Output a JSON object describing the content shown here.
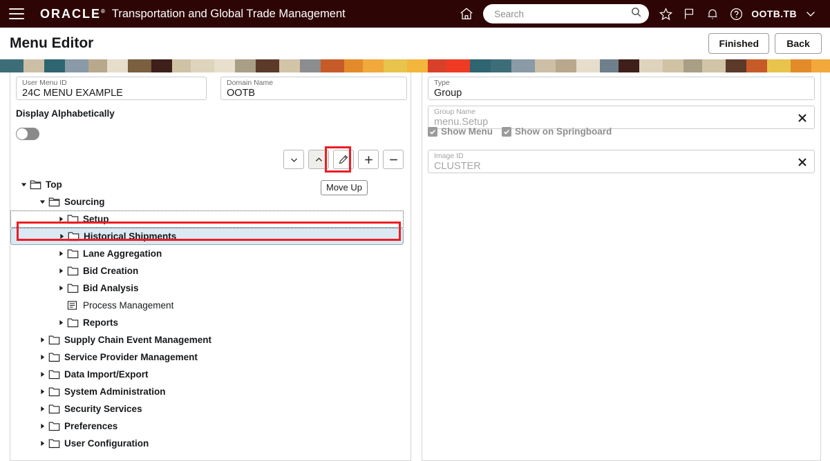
{
  "header": {
    "menu_icon": "hamburger-icon",
    "brand": "ORACLE",
    "brand_mark": "®",
    "app_title": "Transportation and Global Trade Management",
    "home_icon": "home-icon",
    "search_placeholder": "Search",
    "search_value": "",
    "search_icon": "search-icon",
    "favorites_icon": "star-icon",
    "flag_icon": "flag-icon",
    "notifications_icon": "bell-icon",
    "help_icon": "question-circle-icon",
    "user_name": "OOTB.TB",
    "user_chevron_icon": "chevron-down-icon"
  },
  "page": {
    "title": "Menu Editor",
    "finished_label": "Finished",
    "back_label": "Back"
  },
  "banner": {
    "colors": [
      "#3d6e78",
      "#cdbfa6",
      "#2f6570",
      "#8a9aa6",
      "#b9a98c",
      "#e6ddcb",
      "#7b5f3e",
      "#3e1f1a",
      "#cfc2a5",
      "#ded3bc",
      "#e8e0cd",
      "#a99e86",
      "#5c3a2a",
      "#d2c4a6",
      "#8c8d8f",
      "#c75b28",
      "#e38b2a",
      "#f0a93a",
      "#e8c44d",
      "#f2b63c",
      "#d9402a",
      "#ef3b24",
      "#2f6570",
      "#3d6e78",
      "#8a9aa6",
      "#cdbfa6",
      "#b9a98c",
      "#e6ddcb",
      "#6f7f8c",
      "#3e1f1a",
      "#ded3bc",
      "#cfc2a5",
      "#a99e86",
      "#d2c4a6",
      "#5c3a2a",
      "#c75b28",
      "#e8c44d",
      "#e38b2a",
      "#f0a93a",
      "#d9402a"
    ]
  },
  "left_pane": {
    "user_menu_id": {
      "label": "User Menu ID",
      "value": "24C MENU EXAMPLE"
    },
    "domain_name": {
      "label": "Domain Name",
      "value": "OOTB"
    },
    "display_alphabetically": {
      "label": "Display Alphabetically",
      "state": "off"
    },
    "toolbar": [
      {
        "name": "move-down-button",
        "icon": "chevron-down-icon",
        "tooltip": "Move Down",
        "active": false
      },
      {
        "name": "move-up-button",
        "icon": "chevron-up-icon",
        "tooltip": "Move Up",
        "active": true
      },
      {
        "name": "edit-button",
        "icon": "pencil-icon",
        "tooltip": "Edit",
        "active": false
      },
      {
        "name": "add-button",
        "icon": "plus-icon",
        "tooltip": "Add",
        "active": false
      },
      {
        "name": "remove-button",
        "icon": "minus-icon",
        "tooltip": "Remove",
        "active": false
      }
    ],
    "tooltip_text": "Move Up",
    "tree": [
      {
        "label": "Top",
        "level": 0,
        "icon": "folder-open-icon",
        "twist": "expanded",
        "bold": true,
        "state": "normal"
      },
      {
        "label": "Sourcing",
        "level": 1,
        "icon": "folder-open-icon",
        "twist": "expanded",
        "bold": true,
        "state": "normal"
      },
      {
        "label": "Setup",
        "level": 2,
        "icon": "folder-icon",
        "twist": "collapsed",
        "bold": true,
        "state": "focused"
      },
      {
        "label": "Historical Shipments",
        "level": 2,
        "icon": "folder-icon",
        "twist": "collapsed",
        "bold": true,
        "state": "selected"
      },
      {
        "label": "Lane Aggregation",
        "level": 2,
        "icon": "folder-icon",
        "twist": "collapsed",
        "bold": true,
        "state": "normal"
      },
      {
        "label": "Bid Creation",
        "level": 2,
        "icon": "folder-icon",
        "twist": "collapsed",
        "bold": true,
        "state": "normal"
      },
      {
        "label": "Bid Analysis",
        "level": 2,
        "icon": "folder-icon",
        "twist": "collapsed",
        "bold": true,
        "state": "normal"
      },
      {
        "label": "Process Management",
        "level": 2,
        "icon": "document-icon",
        "twist": "none",
        "bold": false,
        "state": "normal"
      },
      {
        "label": "Reports",
        "level": 2,
        "icon": "folder-icon",
        "twist": "collapsed",
        "bold": true,
        "state": "normal"
      },
      {
        "label": "Supply Chain Event Management",
        "level": 1,
        "icon": "folder-icon",
        "twist": "collapsed",
        "bold": true,
        "state": "normal"
      },
      {
        "label": "Service Provider Management",
        "level": 1,
        "icon": "folder-icon",
        "twist": "collapsed",
        "bold": true,
        "state": "normal"
      },
      {
        "label": "Data Import/Export",
        "level": 1,
        "icon": "folder-icon",
        "twist": "collapsed",
        "bold": true,
        "state": "normal"
      },
      {
        "label": "System Administration",
        "level": 1,
        "icon": "folder-icon",
        "twist": "collapsed",
        "bold": true,
        "state": "normal"
      },
      {
        "label": "Security Services",
        "level": 1,
        "icon": "folder-icon",
        "twist": "collapsed",
        "bold": true,
        "state": "normal"
      },
      {
        "label": "Preferences",
        "level": 1,
        "icon": "folder-icon",
        "twist": "collapsed",
        "bold": true,
        "state": "normal"
      },
      {
        "label": "User Configuration",
        "level": 1,
        "icon": "folder-icon",
        "twist": "collapsed",
        "bold": true,
        "state": "normal"
      }
    ]
  },
  "right_pane": {
    "type": {
      "label": "Type",
      "value": "Group"
    },
    "group_name": {
      "label": "Group Name",
      "value": "menu.Setup",
      "clear_icon": "close-icon"
    },
    "show_menu": {
      "label": "Show Menu",
      "checked": true
    },
    "show_on_springboard": {
      "label": "Show on Springboard",
      "checked": true
    },
    "image_id": {
      "label": "Image ID",
      "value": "CLUSTER",
      "clear_icon": "close-icon"
    }
  },
  "colors": {
    "header_bg": "#2e0505",
    "accent_red": "#ee1c25",
    "selection_bg": "#dce9f2",
    "border": "#c8ccd0"
  }
}
